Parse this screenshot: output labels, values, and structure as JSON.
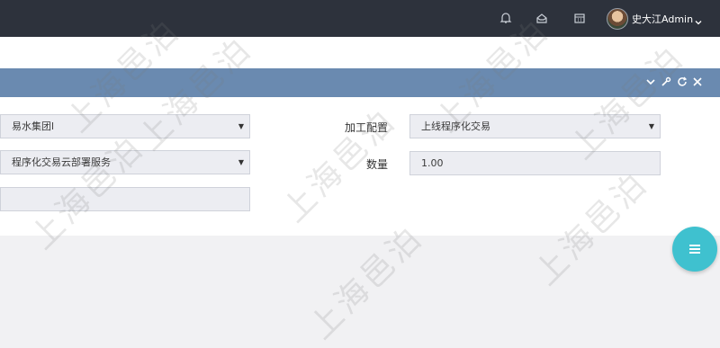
{
  "header": {
    "user_name": "史大江Admin",
    "icons": [
      "bell-icon",
      "inbox-icon",
      "calendar-icon",
      "chevron-down-icon"
    ]
  },
  "panel": {
    "tools": [
      "collapse-icon",
      "wrench-icon",
      "refresh-icon",
      "close-icon"
    ]
  },
  "form": {
    "company_value": "易水集团l",
    "service_value": "程序化交易云部署服务",
    "text_value": "",
    "processing_label": "加工配置",
    "processing_value": "上线程序化交易",
    "quantity_label": "数量",
    "quantity_value": "1.00"
  },
  "watermark": "上海邑泊",
  "colors": {
    "topbar": "#2d323c",
    "panel_header": "#6a8ab0",
    "fab": "#3fc1cf"
  }
}
